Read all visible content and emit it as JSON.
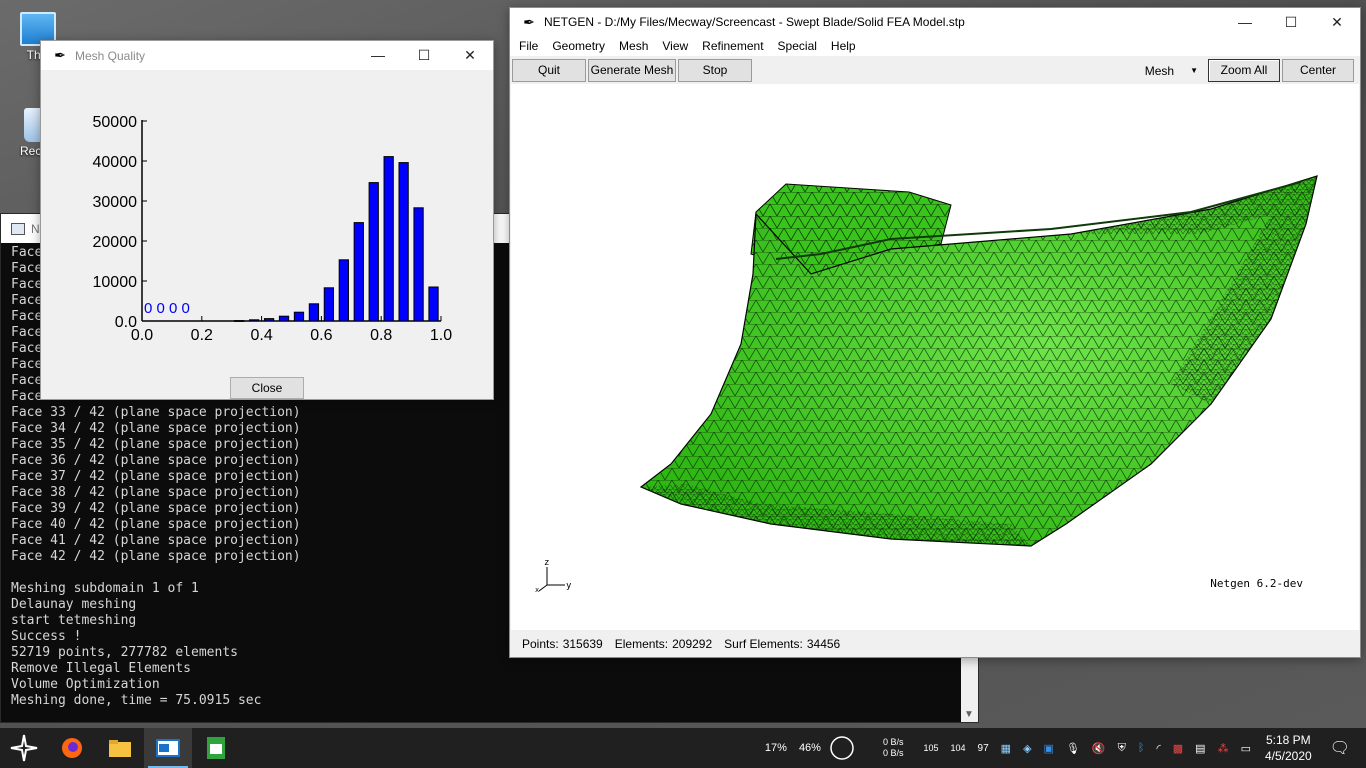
{
  "desktop": {
    "icons": [
      {
        "label": "This"
      },
      {
        "label": "Recycl"
      }
    ]
  },
  "console": {
    "title": "N",
    "lines": [
      "Face",
      "Face",
      "Face",
      "Face",
      "Face",
      "Face",
      "Face",
      "Face",
      "Face",
      "Face",
      "Face 33 / 42 (plane space projection)",
      "Face 34 / 42 (plane space projection)",
      "Face 35 / 42 (plane space projection)",
      "Face 36 / 42 (plane space projection)",
      "Face 37 / 42 (plane space projection)",
      "Face 38 / 42 (plane space projection)",
      "Face 39 / 42 (plane space projection)",
      "Face 40 / 42 (plane space projection)",
      "Face 41 / 42 (plane space projection)",
      "Face 42 / 42 (plane space projection)",
      "",
      "Meshing subdomain 1 of 1",
      "Delaunay meshing",
      "start tetmeshing",
      "Success !",
      "52719 points, 277782 elements",
      "Remove Illegal Elements",
      "Volume Optimization",
      "Meshing done, time = 75.0915 sec"
    ]
  },
  "mesh_quality": {
    "title": "Mesh Quality",
    "close_label": "Close",
    "zero_label": "0 0 0 0"
  },
  "chart_data": {
    "type": "bar",
    "x": [
      0.025,
      0.075,
      0.125,
      0.175,
      0.225,
      0.275,
      0.325,
      0.375,
      0.425,
      0.475,
      0.525,
      0.575,
      0.625,
      0.675,
      0.725,
      0.775,
      0.825,
      0.875,
      0.925,
      0.975
    ],
    "values": [
      0,
      0,
      0,
      0,
      0,
      0,
      100,
      300,
      600,
      1200,
      2200,
      4300,
      8300,
      15300,
      24600,
      34600,
      41100,
      39600,
      28300,
      8500
    ],
    "xlim": [
      0,
      1
    ],
    "ylim": [
      0,
      50000
    ],
    "xticks": [
      "0.0",
      "0.2",
      "0.4",
      "0.6",
      "0.8",
      "1.0"
    ],
    "yticks": [
      "0.0",
      "10000",
      "20000",
      "30000",
      "40000",
      "50000"
    ],
    "bar_color": "#0000ff"
  },
  "netgen": {
    "title": "NETGEN - D:/My Files/Mecway/Screencast - Swept Blade/Solid FEA Model.stp",
    "menu": [
      "File",
      "Geometry",
      "Mesh",
      "View",
      "Refinement",
      "Special",
      "Help"
    ],
    "buttons": {
      "quit": "Quit",
      "generate": "Generate Mesh",
      "stop": "Stop",
      "zoom_all": "Zoom All",
      "center": "Center"
    },
    "view_select": "Mesh",
    "version": "Netgen 6.2-dev",
    "axis_labels": {
      "z": "z",
      "y": "y",
      "x": "x"
    },
    "mesh_color": "#3ccf1e",
    "status": {
      "points_label": "Points:",
      "points_value": "315639",
      "elements_label": "Elements:",
      "elements_value": "209292",
      "surf_label": "Surf Elements:",
      "surf_value": "34456"
    }
  },
  "taskbar": {
    "tray": {
      "cpu": "17%",
      "mem": "46%",
      "net_up": "0 B/s",
      "net_down": "0 B/s",
      "n1": "105",
      "n2": "104",
      "n3": "97",
      "time": "5:18 PM",
      "date": "4/5/2020"
    }
  }
}
